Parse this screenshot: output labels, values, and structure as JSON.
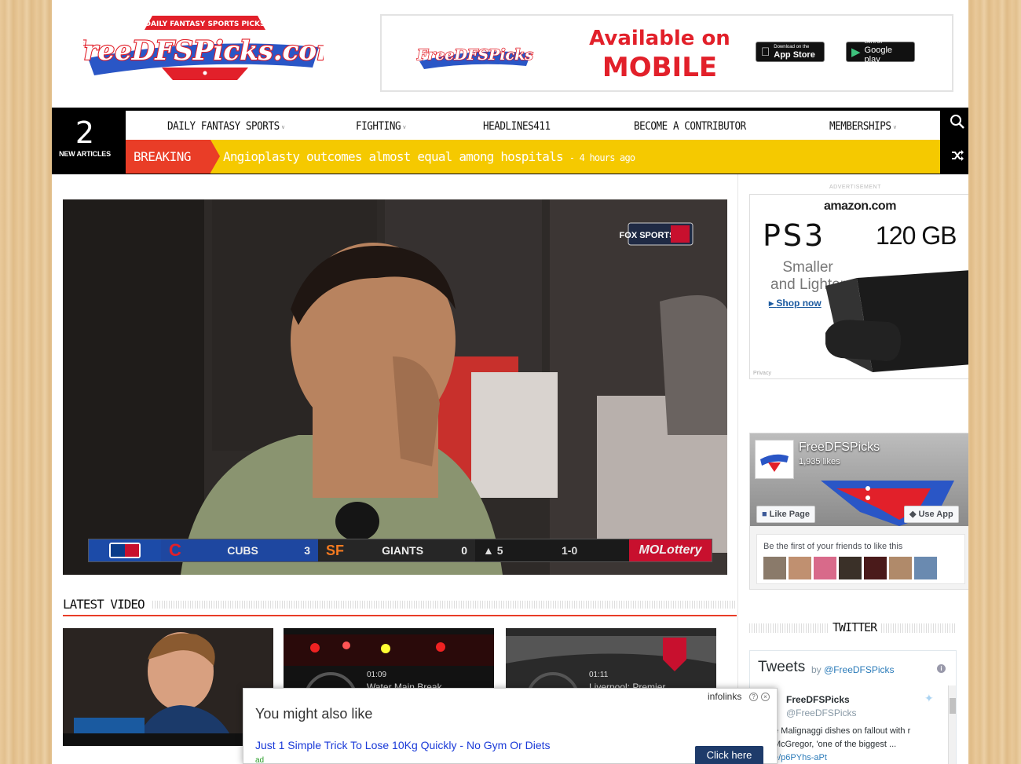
{
  "header": {
    "logo_tagline": "DAILY FANTASY SPORTS PICKS",
    "logo_text": "FreeDFSPicks.com",
    "banner": {
      "logo_text": "FreeDFSPicks",
      "line1": "Available on",
      "line2": "MOBILE",
      "app_store_small": "Download on the",
      "app_store_big": "App Store",
      "google_play_small": "Get it on",
      "google_play_big": "Google play"
    }
  },
  "nav": {
    "article_count": "2",
    "article_label": "NEW ARTICLES",
    "items": [
      {
        "label": "DAILY FANTASY SPORTS",
        "caret": "˅"
      },
      {
        "label": "FIGHTING",
        "caret": "˅"
      },
      {
        "label": "HEADLINES411",
        "caret": ""
      },
      {
        "label": "BECOME A CONTRIBUTOR",
        "caret": ""
      },
      {
        "label": "MEMBERSHIPS",
        "caret": "˅"
      }
    ],
    "breaking_label": "BREAKING",
    "breaking_text": "Angioplasty outcomes almost equal among hospitals",
    "breaking_time": "- 4 hours ago"
  },
  "video": {
    "network_badge": "FOX SPORTS",
    "scoreboard": {
      "team1": "CUBS",
      "score1": "3",
      "team2": "GIANTS",
      "score2": "0",
      "inning": "▲ 5",
      "count": "1-0",
      "sponsor": "MOLottery"
    }
  },
  "latest": {
    "title": "LATEST VIDEO",
    "thumbs": [
      {
        "time": "",
        "title": ""
      },
      {
        "time": "01:09",
        "title": "Water Main Break"
      },
      {
        "time": "01:11",
        "title": "Liverpool: Premier"
      }
    ]
  },
  "sidebar": {
    "ad_label": "ADVERTISEMENT",
    "amazon": {
      "logo": "amazon.com",
      "product": "PS3",
      "capacity": "120 GB",
      "line1": "Smaller",
      "line2": "and Lighter",
      "shop": "Shop now",
      "privacy": "Privacy"
    },
    "facebook": {
      "page_name": "FreeDFSPicks",
      "likes": "1,935 likes",
      "like_btn": "Like Page",
      "app_btn": "Use App",
      "friends_text": "Be the first of your friends to like this"
    },
    "twitter": {
      "section_title": "TWITTER",
      "widget_title": "Tweets",
      "by_prefix": "by",
      "handle": "@FreeDFSPicks",
      "tweet_name": "FreeDFSPicks",
      "tweet_handle": "@FreeDFSPicks",
      "tweet_text": "e Malignaggi dishes on fallout with r McGregor, 'one of the biggest ...",
      "tweet_link": "e/p6PYhs-aPt"
    }
  },
  "popup": {
    "brand": "infolinks",
    "title": "You might also like",
    "link_text": "Just 1 Simple Trick To Lose 10Kg Quickly - No Gym Or Diets",
    "ad_tag": "ad",
    "button": "Click here"
  },
  "colors": {
    "accent_red": "#e93d27",
    "breaking_yellow": "#f5c900",
    "nav_black": "#000000"
  }
}
